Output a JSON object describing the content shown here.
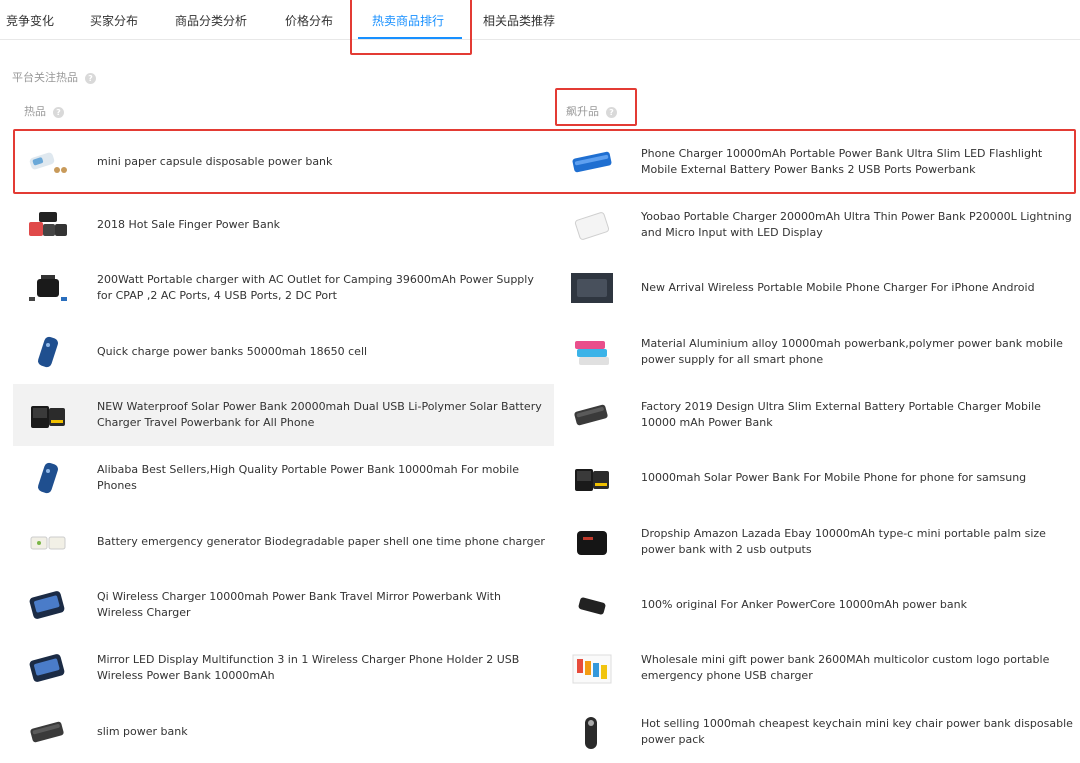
{
  "tabs": [
    {
      "label": "竞争变化"
    },
    {
      "label": "买家分布"
    },
    {
      "label": "商品分类分析"
    },
    {
      "label": "价格分布"
    },
    {
      "label": "热卖商品排行"
    },
    {
      "label": "相关品类推荐"
    }
  ],
  "active_tab": "热卖商品排行",
  "section_title": "平台关注热品",
  "columns": {
    "left": "热品",
    "right": "飙升品"
  },
  "help_glyph": "?",
  "accent_color": "#1890ff",
  "highlight_color": "#e33b34",
  "hot_products": [
    {
      "name": "mini paper capsule disposable power bank",
      "icon": "capsule-power-bank-icon"
    },
    {
      "name": "2018 Hot Sale Finger Power Bank",
      "icon": "finger-power-bank-icon"
    },
    {
      "name": "200Watt Portable charger with AC Outlet for Camping 39600mAh Power Supply for CPAP ,2 AC Ports, 4 USB Ports, 2 DC Port",
      "icon": "portable-charger-icon"
    },
    {
      "name": "Quick charge power banks 50000mah 18650 cell",
      "icon": "power-bank-icon"
    },
    {
      "name": "NEW Waterproof Solar Power Bank 20000mah Dual USB Li-Polymer Solar Battery Charger Travel Powerbank for All Phone",
      "icon": "solar-power-bank-icon"
    },
    {
      "name": "Alibaba Best Sellers,High Quality Portable Power Bank 10000mah For mobile Phones",
      "icon": "power-bank-icon"
    },
    {
      "name": "Battery emergency generator Biodegradable paper shell one time phone charger",
      "icon": "paper-charger-icon"
    },
    {
      "name": "Qi Wireless Charger 10000mah Power Bank Travel Mirror Powerbank With Wireless Charger",
      "icon": "wireless-charger-icon"
    },
    {
      "name": "Mirror LED Display Multifunction 3 in 1 Wireless Charger Phone Holder 2 USB Wireless Power Bank 10000mAh",
      "icon": "wireless-charger-icon"
    },
    {
      "name": "slim power bank",
      "icon": "slim-power-bank-icon"
    }
  ],
  "rising_products": [
    {
      "name": "Phone Charger 10000mAh Portable Power Bank Ultra Slim LED Flashlight Mobile External Battery Power Banks 2 USB Ports Powerbank",
      "icon": "blue-power-bank-icon"
    },
    {
      "name": "Yoobao Portable Charger 20000mAh Ultra Thin Power Bank P20000L Lightning and Micro Input with LED Display",
      "icon": "white-power-bank-icon"
    },
    {
      "name": "New Arrival Wireless Portable Mobile Phone Charger For iPhone Android",
      "icon": "dark-power-bank-icon"
    },
    {
      "name": "Material Aluminium alloy 10000mah powerbank,polymer power bank mobile power supply for all smart phone",
      "icon": "colorful-power-bank-icon"
    },
    {
      "name": "Factory 2019 Design Ultra Slim External Battery Portable Charger Mobile 10000 mAh Power Bank",
      "icon": "slim-power-bank-icon"
    },
    {
      "name": "10000mah Solar Power Bank For Mobile Phone for phone for samsung",
      "icon": "solar-power-bank-icon"
    },
    {
      "name": "Dropship Amazon Lazada Ebay 10000mAh type-c mini portable palm size power bank with 2 usb outputs",
      "icon": "mini-power-bank-icon"
    },
    {
      "name": "100% original For Anker PowerCore 10000mAh power bank",
      "icon": "black-power-bank-icon"
    },
    {
      "name": "Wholesale mini gift power bank 2600MAh multicolor custom logo portable emergency phone USB charger",
      "icon": "gift-power-bank-icon"
    },
    {
      "name": "Hot selling 1000mah cheapest keychain mini key chair power bank disposable power pack",
      "icon": "keychain-power-bank-icon"
    }
  ]
}
